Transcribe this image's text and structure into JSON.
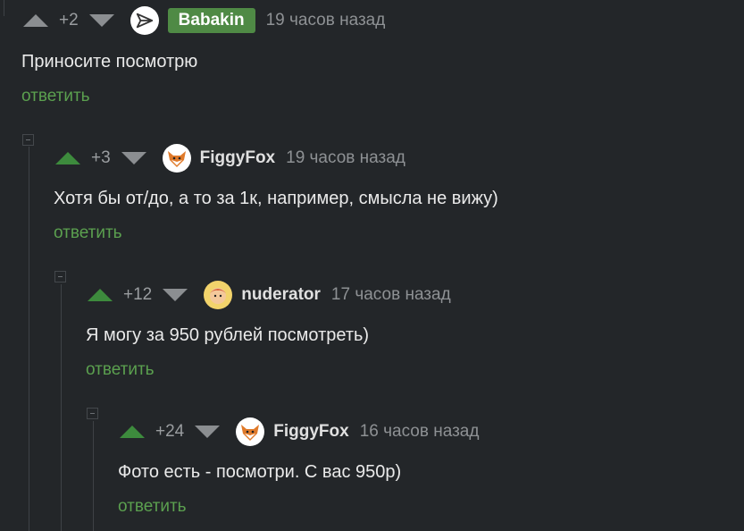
{
  "comments": [
    {
      "rating": "+2",
      "username": "Babakin",
      "time": "19 часов назад",
      "text": "Приносите посмотрю",
      "reply": "ответить",
      "avatar_icon": "paper-plane-icon"
    },
    {
      "rating": "+3",
      "username": "FiggyFox",
      "time": "19 часов назад",
      "text": "Хотя бы от/до, а то за 1к, например, смысла не вижу)",
      "reply": "ответить",
      "avatar_icon": "fox-icon"
    },
    {
      "rating": "+12",
      "username": "nuderator",
      "time": "17 часов назад",
      "text": "Я могу за 950 рублей посмотреть)",
      "reply": "ответить",
      "avatar_icon": "cartoon-avatar-icon"
    },
    {
      "rating": "+24",
      "username": "FiggyFox",
      "time": "16 часов назад",
      "text": "Фото есть - посмотри. С вас 950р)",
      "reply": "ответить",
      "avatar_icon": "fox-icon"
    }
  ],
  "colors": {
    "background": "#232629",
    "upvoted": "#3d8b3d",
    "reply_link": "#5ba04f",
    "badge": "#4f8a45"
  }
}
